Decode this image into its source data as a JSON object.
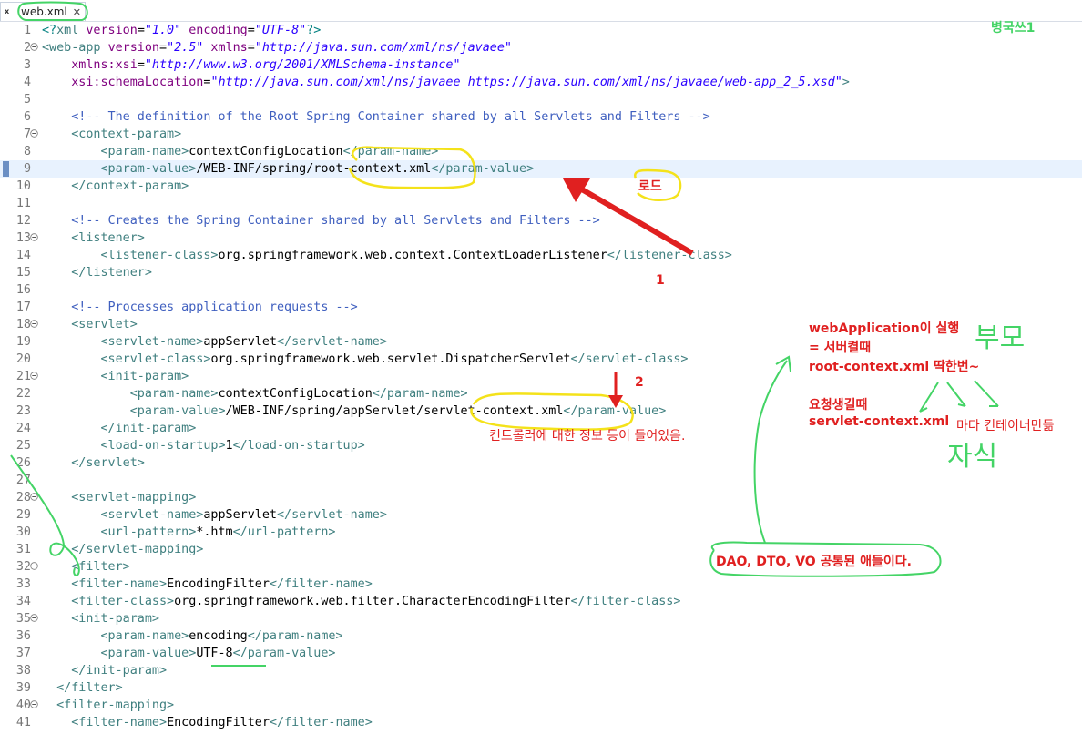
{
  "tab": {
    "label": "web.xml",
    "icon": "xml-file-icon",
    "close": "✕"
  },
  "lines": [
    {
      "n": "1",
      "fold": false,
      "segs": [
        [
          "p",
          "<?"
        ],
        [
          "t",
          "xml "
        ],
        [
          "a",
          "version"
        ],
        [
          "",
          "="
        ],
        [
          "v",
          "\"1.0\""
        ],
        [
          "a",
          " encoding"
        ],
        [
          "",
          "="
        ],
        [
          "v",
          "\"UTF-8\""
        ],
        [
          "p",
          "?>"
        ]
      ]
    },
    {
      "n": "2",
      "fold": true,
      "segs": [
        [
          "t",
          "<web-app "
        ],
        [
          "a",
          "version"
        ],
        [
          "",
          "="
        ],
        [
          "v",
          "\"2.5\""
        ],
        [
          "a",
          " xmlns"
        ],
        [
          "",
          "="
        ],
        [
          "v",
          "\"http://java.sun.com/xml/ns/javaee\""
        ]
      ]
    },
    {
      "n": "3",
      "fold": false,
      "segs": [
        [
          "a",
          "    xmlns:xsi"
        ],
        [
          "",
          "="
        ],
        [
          "v",
          "\"http://www.w3.org/2001/XMLSchema-instance\""
        ]
      ]
    },
    {
      "n": "4",
      "fold": false,
      "segs": [
        [
          "a",
          "    xsi:schemaLocation"
        ],
        [
          "",
          "="
        ],
        [
          "v",
          "\"http://java.sun.com/xml/ns/javaee https://java.sun.com/xml/ns/javaee/web-app_2_5.xsd\""
        ],
        [
          "t",
          ">"
        ]
      ]
    },
    {
      "n": "5",
      "fold": false,
      "segs": []
    },
    {
      "n": "6",
      "fold": false,
      "segs": [
        [
          "c",
          "    <!-- The definition of the Root Spring Container shared by all Servlets and Filters -->"
        ]
      ]
    },
    {
      "n": "7",
      "fold": true,
      "segs": [
        [
          "t",
          "    <context-param>"
        ]
      ]
    },
    {
      "n": "8",
      "fold": false,
      "segs": [
        [
          "t",
          "        <param-name>"
        ],
        [
          "",
          "contextConfigLocation"
        ],
        [
          "t",
          "</param-name>"
        ]
      ]
    },
    {
      "n": "9",
      "fold": false,
      "current": true,
      "segs": [
        [
          "t",
          "        <param-value>"
        ],
        [
          "",
          "/WEB-INF/spring/root-context.xml"
        ],
        [
          "t",
          "</param-value>"
        ]
      ]
    },
    {
      "n": "10",
      "fold": false,
      "segs": [
        [
          "t",
          "    </context-param>"
        ]
      ]
    },
    {
      "n": "11",
      "fold": false,
      "segs": []
    },
    {
      "n": "12",
      "fold": false,
      "segs": [
        [
          "c",
          "    <!-- Creates the Spring Container shared by all Servlets and Filters -->"
        ]
      ]
    },
    {
      "n": "13",
      "fold": true,
      "segs": [
        [
          "t",
          "    <listener>"
        ]
      ]
    },
    {
      "n": "14",
      "fold": false,
      "segs": [
        [
          "t",
          "        <listener-class>"
        ],
        [
          "",
          "org.springframework.web.context.ContextLoaderListener"
        ],
        [
          "t",
          "</listener-class>"
        ]
      ]
    },
    {
      "n": "15",
      "fold": false,
      "segs": [
        [
          "t",
          "    </listener>"
        ]
      ]
    },
    {
      "n": "16",
      "fold": false,
      "segs": []
    },
    {
      "n": "17",
      "fold": false,
      "segs": [
        [
          "c",
          "    <!-- Processes application requests -->"
        ]
      ]
    },
    {
      "n": "18",
      "fold": true,
      "segs": [
        [
          "t",
          "    <servlet>"
        ]
      ]
    },
    {
      "n": "19",
      "fold": false,
      "segs": [
        [
          "t",
          "        <servlet-name>"
        ],
        [
          "",
          "appServlet"
        ],
        [
          "t",
          "</servlet-name>"
        ]
      ]
    },
    {
      "n": "20",
      "fold": false,
      "segs": [
        [
          "t",
          "        <servlet-class>"
        ],
        [
          "",
          "org.springframework.web.servlet.DispatcherServlet"
        ],
        [
          "t",
          "</servlet-class>"
        ]
      ]
    },
    {
      "n": "21",
      "fold": true,
      "segs": [
        [
          "t",
          "        <init-param>"
        ]
      ]
    },
    {
      "n": "22",
      "fold": false,
      "segs": [
        [
          "t",
          "            <param-name>"
        ],
        [
          "",
          "contextConfigLocation"
        ],
        [
          "t",
          "</param-name>"
        ]
      ]
    },
    {
      "n": "23",
      "fold": false,
      "segs": [
        [
          "t",
          "            <param-value>"
        ],
        [
          "",
          "/WEB-INF/spring/appServlet/servlet-context.xml"
        ],
        [
          "t",
          "</param-value>"
        ]
      ]
    },
    {
      "n": "24",
      "fold": false,
      "segs": [
        [
          "t",
          "        </init-param>"
        ]
      ]
    },
    {
      "n": "25",
      "fold": false,
      "segs": [
        [
          "t",
          "        <load-on-startup>"
        ],
        [
          "",
          "1"
        ],
        [
          "t",
          "</load-on-startup>"
        ]
      ]
    },
    {
      "n": "26",
      "fold": false,
      "segs": [
        [
          "t",
          "    </servlet>"
        ]
      ]
    },
    {
      "n": "27",
      "fold": false,
      "segs": []
    },
    {
      "n": "28",
      "fold": true,
      "segs": [
        [
          "t",
          "    <servlet-mapping>"
        ]
      ]
    },
    {
      "n": "29",
      "fold": false,
      "segs": [
        [
          "t",
          "        <servlet-name>"
        ],
        [
          "",
          "appServlet"
        ],
        [
          "t",
          "</servlet-name>"
        ]
      ]
    },
    {
      "n": "30",
      "fold": false,
      "segs": [
        [
          "t",
          "        <url-pattern>"
        ],
        [
          "",
          "*.htm"
        ],
        [
          "t",
          "</url-pattern>"
        ]
      ]
    },
    {
      "n": "31",
      "fold": false,
      "segs": [
        [
          "t",
          "    </servlet-mapping>"
        ]
      ]
    },
    {
      "n": "32",
      "fold": true,
      "segs": [
        [
          "t",
          "    <filter>"
        ]
      ]
    },
    {
      "n": "33",
      "fold": false,
      "segs": [
        [
          "t",
          "    <filter-name>"
        ],
        [
          "",
          "EncodingFilter"
        ],
        [
          "t",
          "</filter-name>"
        ]
      ]
    },
    {
      "n": "34",
      "fold": false,
      "segs": [
        [
          "t",
          "    <filter-class>"
        ],
        [
          "",
          "org.springframework.web.filter.CharacterEncodingFilter"
        ],
        [
          "t",
          "</filter-class>"
        ]
      ]
    },
    {
      "n": "35",
      "fold": true,
      "segs": [
        [
          "t",
          "    <init-param>"
        ]
      ]
    },
    {
      "n": "36",
      "fold": false,
      "segs": [
        [
          "t",
          "        <param-name>"
        ],
        [
          "",
          "encoding"
        ],
        [
          "t",
          "</param-name>"
        ]
      ]
    },
    {
      "n": "37",
      "fold": false,
      "segs": [
        [
          "t",
          "        <param-value>"
        ],
        [
          "",
          "UTF-8"
        ],
        [
          "t",
          "</param-value>"
        ]
      ]
    },
    {
      "n": "38",
      "fold": false,
      "segs": [
        [
          "t",
          "    </init-param>"
        ]
      ]
    },
    {
      "n": "39",
      "fold": false,
      "segs": [
        [
          "t",
          "  </filter>"
        ]
      ]
    },
    {
      "n": "40",
      "fold": true,
      "segs": [
        [
          "t",
          "  <filter-mapping>"
        ]
      ]
    },
    {
      "n": "41",
      "fold": false,
      "segs": [
        [
          "t",
          "    <filter-name>"
        ],
        [
          "",
          "EncodingFilter"
        ],
        [
          "t",
          "</filter-name>"
        ]
      ]
    }
  ],
  "annotations": {
    "author": "병국쓰1",
    "load": "로드",
    "num1": "1",
    "num2": "2",
    "controller_info": "컨트롤러에 대한 정보 등이 들어있음.",
    "note_line1": "webApplication이 실행",
    "note_line2": "= 서버켤때",
    "note_line3": "root-context.xml    딱한번~",
    "note_line4": "요청생길때",
    "note_line5": "servlet-context.xml",
    "note_line6": "마다 컨테이너만듦",
    "parent": "부모",
    "child": "자식",
    "dao_note": "DAO, DTO, VO 공통된 애들이다."
  },
  "colors": {
    "tag": "#3f7f7f",
    "attr": "#7f007f",
    "value": "#2a00ff",
    "comment": "#3f5fbf",
    "annotation_red": "#e02020",
    "highlight_yellow": "#f4e21a",
    "pen_green": "#44d466"
  }
}
